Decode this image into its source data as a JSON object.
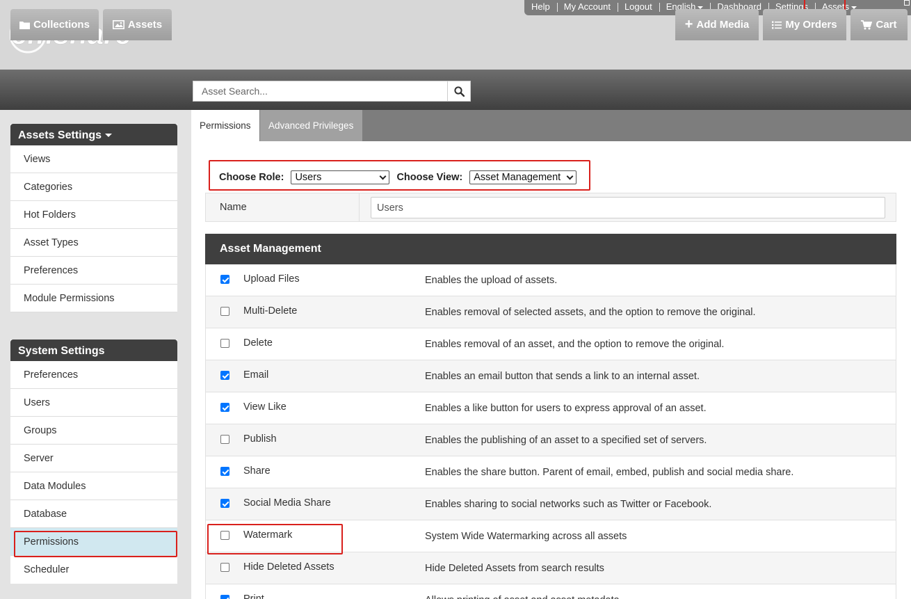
{
  "app": {
    "logo_text": "emshare"
  },
  "top_links": [
    {
      "label": "Help",
      "dropdown": false
    },
    {
      "label": "My Account",
      "dropdown": false
    },
    {
      "label": "Logout",
      "dropdown": false
    },
    {
      "label": "English",
      "dropdown": true
    },
    {
      "label": "Dashboard",
      "dropdown": false
    },
    {
      "label": "Settings",
      "dropdown": false
    },
    {
      "label": "Assets",
      "dropdown": true
    }
  ],
  "nav": {
    "collections": "Collections",
    "assets": "Assets",
    "add_media": "Add Media",
    "my_orders": "My Orders",
    "cart": "Cart"
  },
  "search": {
    "placeholder": "Asset Search..."
  },
  "assets_settings": {
    "title": "Assets Settings",
    "items": [
      "Views",
      "Categories",
      "Hot Folders",
      "Asset Types",
      "Preferences",
      "Module Permissions"
    ]
  },
  "system_settings": {
    "title": "System Settings",
    "items": [
      "Preferences",
      "Users",
      "Groups",
      "Server",
      "Data Modules",
      "Database",
      "Permissions",
      "Scheduler"
    ],
    "active": "Permissions"
  },
  "tabs": [
    {
      "label": "Permissions",
      "active": true
    },
    {
      "label": "Advanced Privileges",
      "active": false
    }
  ],
  "role": {
    "role_label": "Choose Role:",
    "role_value": "Users",
    "view_label": "Choose View:",
    "view_value": "Asset Management"
  },
  "name_row": {
    "label": "Name",
    "value": "Users"
  },
  "section": {
    "title": "Asset Management"
  },
  "permissions": [
    {
      "name": "Upload Files",
      "desc": "Enables the upload of assets.",
      "checked": true
    },
    {
      "name": "Multi-Delete",
      "desc": "Enables removal of selected assets, and the option to remove the original.",
      "checked": false
    },
    {
      "name": "Delete",
      "desc": "Enables removal of an asset, and the option to remove the original.",
      "checked": false
    },
    {
      "name": "Email",
      "desc": "Enables an email button that sends a link to an internal asset.",
      "checked": true
    },
    {
      "name": "View Like",
      "desc": "Enables a like button for users to express approval of an asset.",
      "checked": true
    },
    {
      "name": "Publish",
      "desc": "Enables the publishing of an asset to a specified set of servers.",
      "checked": false
    },
    {
      "name": "Share",
      "desc": "Enables the share button. Parent of email, embed, publish and social media share.",
      "checked": true
    },
    {
      "name": "Social Media Share",
      "desc": "Enables sharing to social networks such as Twitter or Facebook.",
      "checked": true
    },
    {
      "name": "Watermark",
      "desc": "System Wide Watermarking across all assets",
      "checked": false
    },
    {
      "name": "Hide Deleted Assets",
      "desc": "Hide Deleted Assets from search results",
      "checked": false
    },
    {
      "name": "Print",
      "desc": "Allows printing of asset and asset metadata",
      "checked": true
    }
  ],
  "colors": {
    "highlight": "#d9201c",
    "dark_header": "#3f3f3f",
    "active_item": "#d1e8f0",
    "checkbox": "#0075ff"
  }
}
